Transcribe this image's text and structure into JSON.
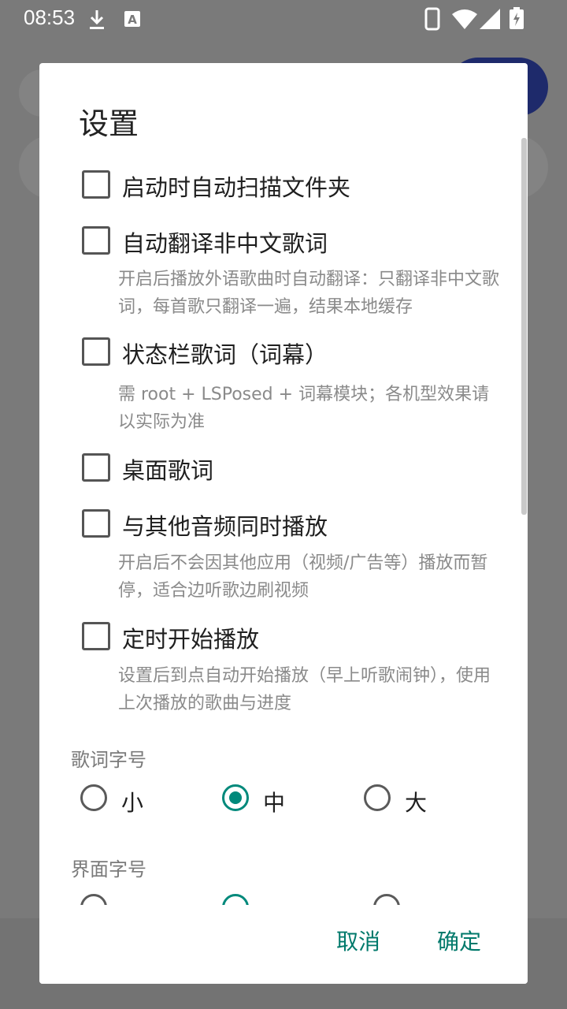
{
  "status_bar": {
    "time": "08:53",
    "icons": [
      "download-icon",
      "a-icon",
      "phone-icon",
      "wifi-icon",
      "signal-icon",
      "battery-charging-icon"
    ]
  },
  "dialog": {
    "title": "设置",
    "options": [
      {
        "label": "启动时自动扫描文件夹",
        "description": "",
        "checked": false
      },
      {
        "label": "自动翻译非中文歌词",
        "description": "开启后播放外语歌曲时自动翻译：只翻译非中文歌词，每首歌只翻译一遍，结果本地缓存",
        "checked": false
      },
      {
        "label": "状态栏歌词（词幕）",
        "description": "需 root + LSPosed + 词幕模块；各机型效果请以实际为准",
        "checked": false
      },
      {
        "label": "桌面歌词",
        "description": "",
        "checked": false
      },
      {
        "label": "与其他音频同时播放",
        "description": "开启后不会因其他应用（视频/广告等）播放而暂停，适合边听歌边刷视频",
        "checked": false
      },
      {
        "label": "定时开始播放",
        "description": "设置后到点自动开始播放（早上听歌闹钟），使用上次播放的歌曲与进度",
        "checked": false
      }
    ],
    "lyric_font_size": {
      "label": "歌词字号",
      "options": [
        "小",
        "中",
        "大"
      ],
      "selected": "中"
    },
    "ui_font_size": {
      "label": "界面字号"
    },
    "cancel_label": "取消",
    "confirm_label": "确定",
    "accent_color": "#00897b"
  }
}
